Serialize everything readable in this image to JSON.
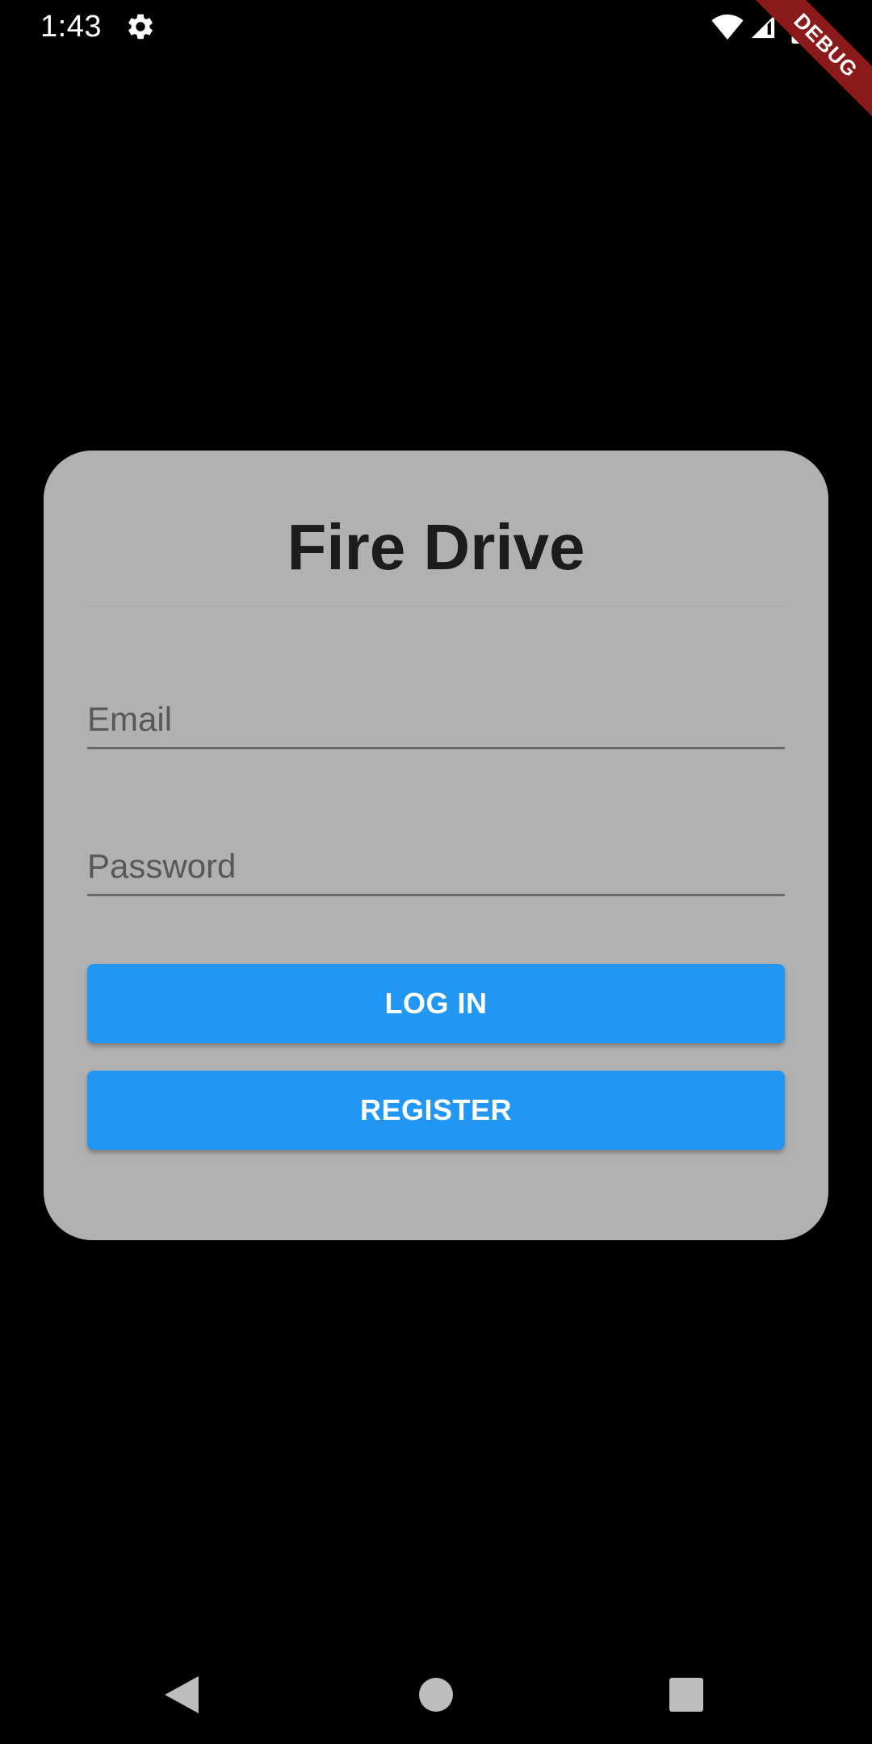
{
  "status_bar": {
    "time": "1:43",
    "icons": [
      "settings-gear-icon",
      "wifi-icon",
      "cellular-signal-icon",
      "battery-icon"
    ]
  },
  "debug_banner": "DEBUG",
  "login_card": {
    "title": "Fire Drive",
    "email": {
      "placeholder": "Email",
      "value": ""
    },
    "password": {
      "placeholder": "Password",
      "value": ""
    },
    "login_button_label": "LOG IN",
    "register_button_label": "REGISTER"
  },
  "nav_bar": {
    "icons": [
      "back-icon",
      "home-icon",
      "recents-icon"
    ]
  },
  "colors": {
    "background": "#000000",
    "card": "#b1b1b1",
    "button": "#2196f3",
    "title": "#1c1c1c",
    "debug_ribbon": "#8b1a1a"
  }
}
